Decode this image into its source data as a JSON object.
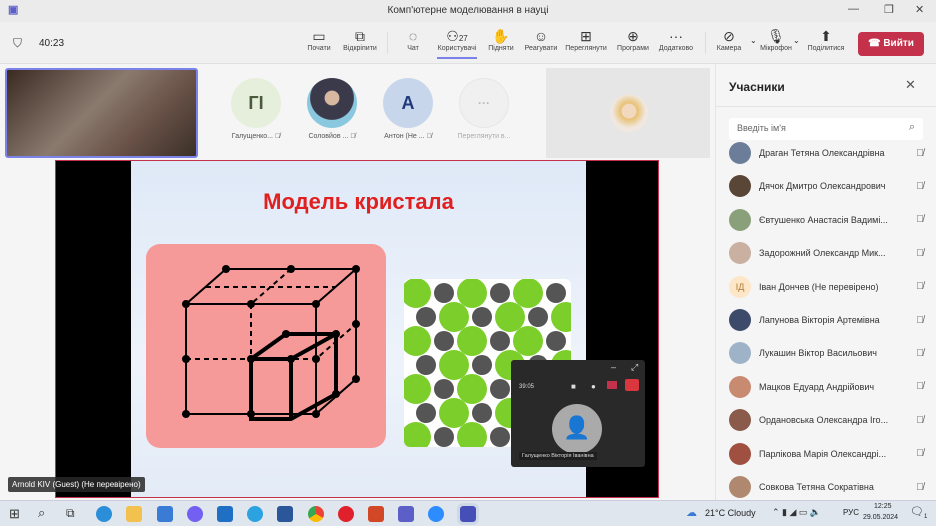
{
  "window": {
    "title": "Комп'ютерне моделювання в науці",
    "timer": "40:23"
  },
  "toolbar": {
    "items": [
      {
        "label": "Почати",
        "icon": "share-screen-icon"
      },
      {
        "label": "Відкріпити",
        "icon": "popout-icon"
      },
      {
        "label": "Чат",
        "icon": "chat-icon"
      },
      {
        "label": "Користувачі",
        "icon": "people-icon",
        "count": "27"
      },
      {
        "label": "Підняти",
        "icon": "raise-hand-icon"
      },
      {
        "label": "Реагувати",
        "icon": "react-icon"
      },
      {
        "label": "Переглянути",
        "icon": "view-icon"
      },
      {
        "label": "Програми",
        "icon": "apps-icon"
      },
      {
        "label": "Додатково",
        "icon": "more-icon"
      },
      {
        "label": "Камера",
        "icon": "camera-off-icon"
      },
      {
        "label": "Мікрофон",
        "icon": "mic-off-icon"
      },
      {
        "label": "Поділитися",
        "icon": "share-icon"
      }
    ],
    "leave": "Вийти"
  },
  "stage": {
    "participants": [
      {
        "initials": "ГІ",
        "name": "Галущенко...",
        "color": "#e6efdc"
      },
      {
        "initials": "",
        "name": "Соловйов ...",
        "color": "#4a7fa6"
      },
      {
        "initials": "А",
        "name": "Антон (Не ...",
        "color": "#c8d6ec"
      },
      {
        "initials": "···",
        "name": "Переглянути в...",
        "color": "#f0f0f0"
      }
    ],
    "slide_title": "Модель кристала",
    "guest_label": "Arnold KIV (Guest) (Не перевірено)",
    "mini": {
      "timer": "39:05",
      "name": "Галущенко Вікторія Іванівна"
    }
  },
  "panel": {
    "title": "Учасники",
    "search_placeholder": "Введіть ім'я",
    "people": [
      {
        "name": "Драган Тетяна Олександрівна",
        "color": "#6b7d98"
      },
      {
        "name": "Дячок Дмитро Олександрович",
        "color": "#5a4636"
      },
      {
        "name": "Євтушенко Анастасія Вадимі...",
        "color": "#8aa07a"
      },
      {
        "name": "Задорожний Олександр Мик...",
        "color": "#c9b0a0"
      },
      {
        "name": "Іван Дончев (Не перевірено)",
        "color": "#fde7c8",
        "initials": "ІД"
      },
      {
        "name": "Лапунова Вікторія Артемівна",
        "color": "#3d4a6a"
      },
      {
        "name": "Лукашин Віктор Васильович",
        "color": "#9fb3c8"
      },
      {
        "name": "Мацков Едуард Андрійович",
        "color": "#c88a70"
      },
      {
        "name": "Ордановська Олександра Іго...",
        "color": "#8a5a4a"
      },
      {
        "name": "Парлікова Марія Олександрі...",
        "color": "#a05040"
      },
      {
        "name": "Совкова Тетяна Сократівна",
        "color": "#b08870"
      }
    ]
  },
  "taskbar": {
    "weather": "21°C  Cloudy",
    "lang": "РУС",
    "time": "12:25",
    "date": "29.05.2024",
    "notifications": "1"
  }
}
